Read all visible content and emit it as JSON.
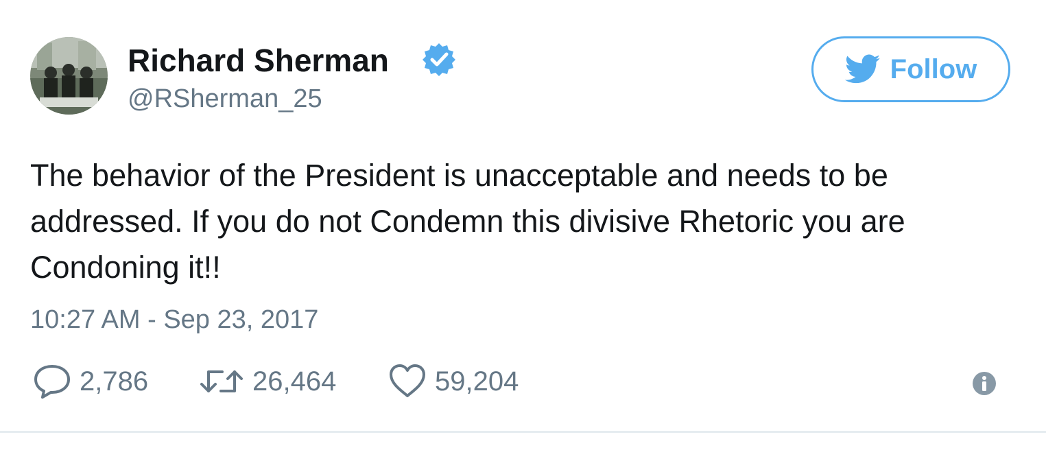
{
  "author": {
    "display_name": "Richard Sherman",
    "handle": "@RSherman_25",
    "verified": true,
    "avatar_icon": "avatar-photo"
  },
  "follow_button": {
    "label": "Follow",
    "icon": "twitter-bird-icon"
  },
  "tweet": {
    "text": "The behavior of the President is unacceptable and needs to be addressed. If you do not Condemn this divisive Rhetoric you are Condoning it!!",
    "timestamp": "10:27 AM - Sep 23, 2017"
  },
  "actions": {
    "replies": "2,786",
    "retweets": "26,464",
    "likes": "59,204"
  },
  "colors": {
    "accent": "#55acee",
    "text": "#14171a",
    "secondary": "#657786",
    "divider": "#e6ecf0"
  }
}
